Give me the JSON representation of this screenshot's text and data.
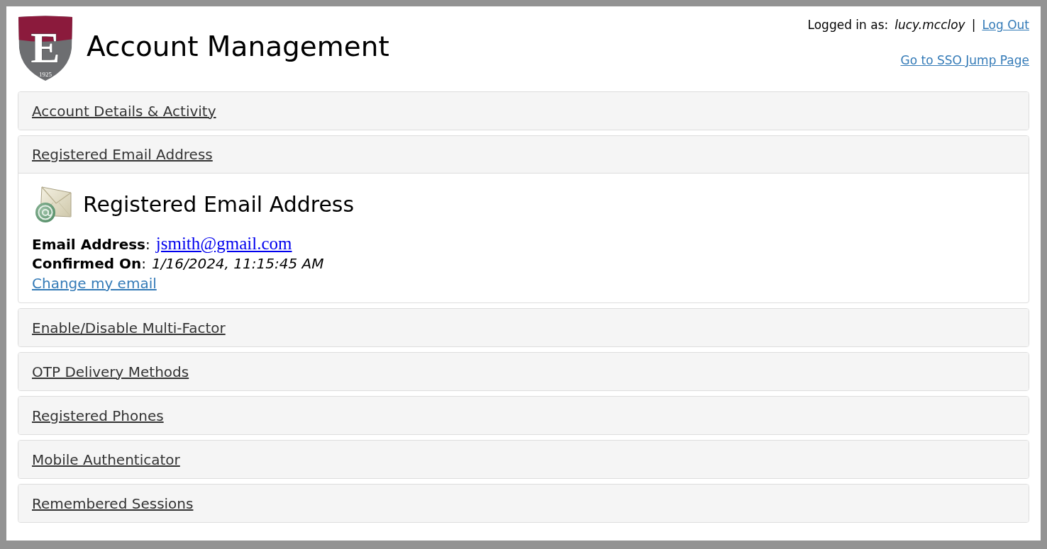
{
  "logo": {
    "letter": "E",
    "year": "1925"
  },
  "header": {
    "title": "Account Management",
    "user_label": "Logged in as:",
    "username": "lucy.mccloy",
    "separator": "|",
    "logout_link": "Log Out",
    "sso_link": "Go to SSO Jump Page"
  },
  "sections": [
    {
      "title": "Account Details & Activity",
      "expanded": false
    },
    {
      "title": "Registered Email Address",
      "expanded": true,
      "content": {
        "heading": "Registered Email Address",
        "fields": [
          {
            "label": "**Email Address**:",
            "value": "jsmith@gmail.com",
            "kind": "link"
          },
          {
            "label": "**Confirmed On**:",
            "value": "1/16/2024, 11:15:45 AM",
            "kind": "text"
          }
        ],
        "action_link": "Change my email"
      }
    },
    {
      "title": "Enable/Disable Multi-Factor",
      "expanded": false
    },
    {
      "title": "OTP Delivery Methods",
      "expanded": false
    },
    {
      "title": "Registered Phones",
      "expanded": false
    },
    {
      "title": "Mobile Authenticator",
      "expanded": false
    },
    {
      "title": "Remembered Sessions",
      "expanded": false
    }
  ]
}
